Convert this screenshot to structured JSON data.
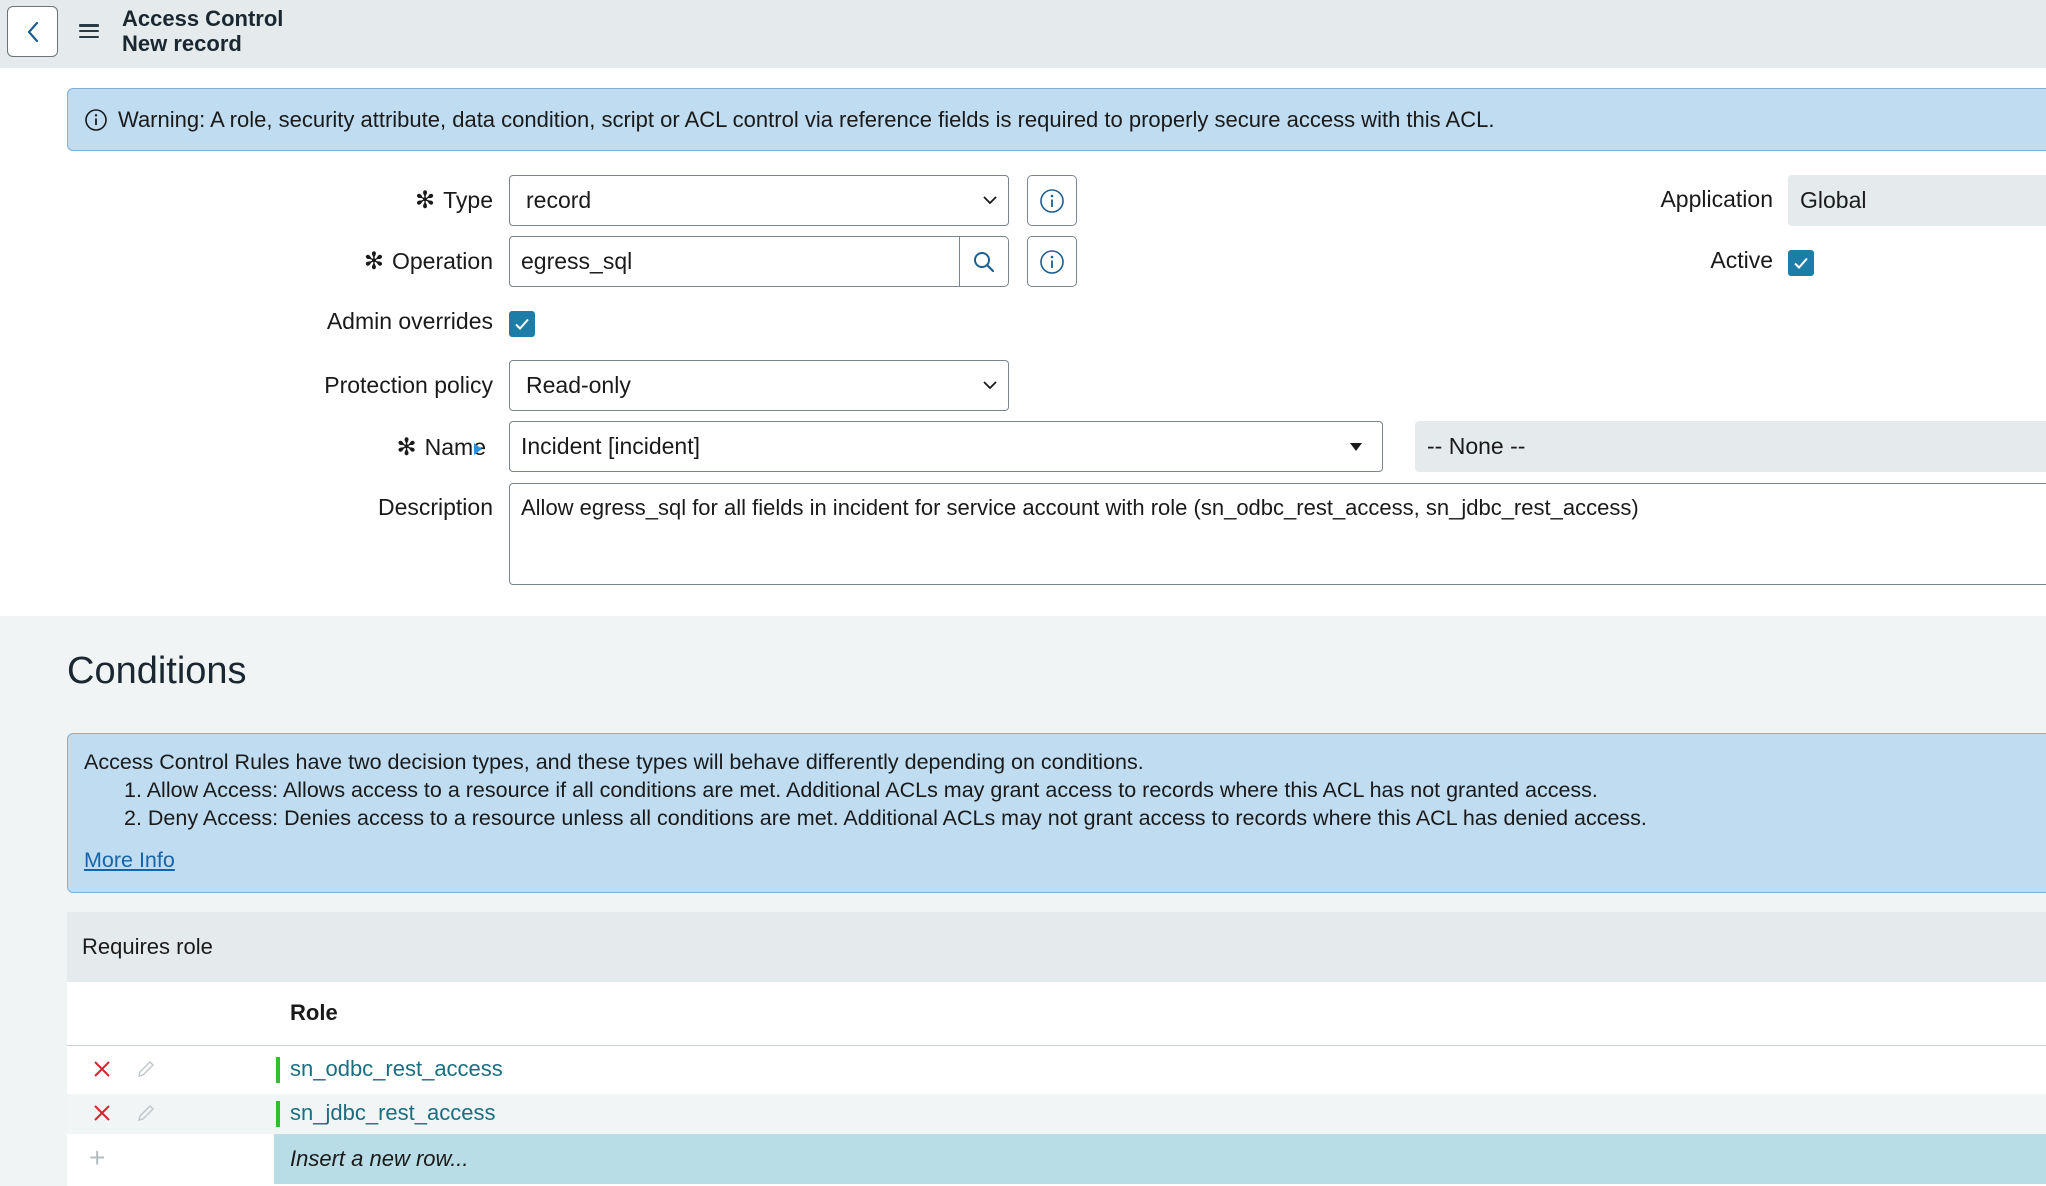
{
  "header": {
    "title": "Access Control",
    "subtitle": "New record",
    "back_icon": "chevron-left-icon",
    "menu_icon": "hamburger-menu-icon"
  },
  "warning": {
    "text": "Warning: A role, security attribute, data condition, script or ACL control via reference fields is required to properly secure access with this ACL."
  },
  "form": {
    "type": {
      "label": "Type",
      "value": "record",
      "required": true
    },
    "operation": {
      "label": "Operation",
      "value": "egress_sql",
      "required": true
    },
    "admin_overrides": {
      "label": "Admin overrides",
      "checked": true
    },
    "protection_policy": {
      "label": "Protection policy",
      "value": "Read-only"
    },
    "name": {
      "label": "Name",
      "value": "Incident [incident]",
      "field_value": "-- None --",
      "required": true
    },
    "description": {
      "label": "Description",
      "value": "Allow egress_sql for all fields in incident for service account with role (sn_odbc_rest_access, sn_jdbc_rest_access)"
    },
    "application": {
      "label": "Application",
      "value": "Global"
    },
    "active": {
      "label": "Active",
      "checked": true
    }
  },
  "conditions": {
    "title": "Conditions",
    "info_line1": "Access Control Rules have two decision types, and these types will behave differently depending on conditions.",
    "info_line2": "1. Allow Access: Allows access to a resource if all conditions are met. Additional ACLs may grant access to records where this ACL has not granted access.",
    "info_line3": "2. Deny Access: Denies access to a resource unless all conditions are met. Additional ACLs may not grant access to records where this ACL has denied access.",
    "more_info": "More Info"
  },
  "requires_role": {
    "title": "Requires role",
    "column_header": "Role",
    "rows": [
      {
        "role": "sn_odbc_rest_access"
      },
      {
        "role": "sn_jdbc_rest_access"
      }
    ],
    "insert_placeholder": "Insert a new row..."
  },
  "colors": {
    "accent": "#1c7ea6",
    "header_bg": "#e5ebed",
    "info_bg": "#bfdcf0",
    "delete": "#d9232e",
    "status_bar": "#2fbf2f",
    "insert_bg": "#b9dde7"
  }
}
